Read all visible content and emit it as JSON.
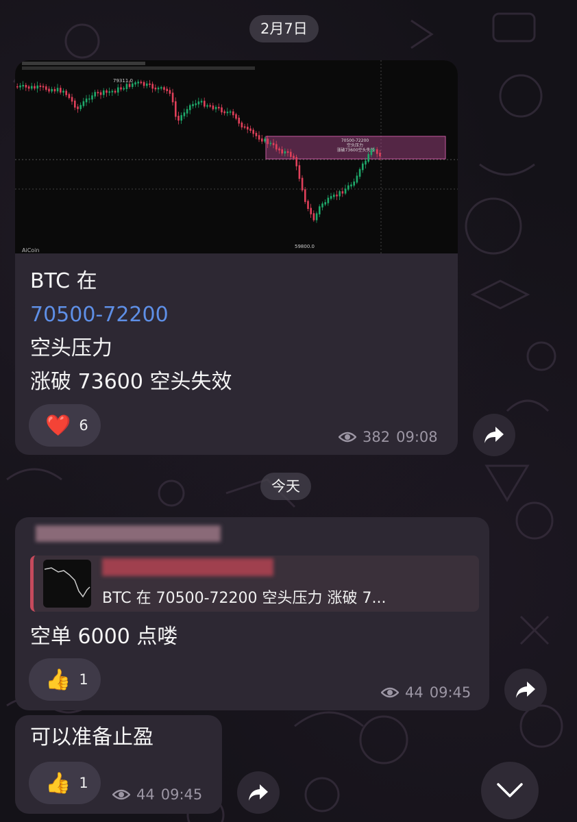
{
  "date_divider_1": "2月7日",
  "date_divider_2": "今天",
  "message1": {
    "chart_watermark": "AiCoin",
    "chart_high_label": "79311.0",
    "chart_low_label": "59800.0",
    "chart_zone_text": [
      "70500-72200",
      "空头压力",
      "涨破73600空头失效"
    ],
    "line1": "BTC 在",
    "line2": "70500-72200",
    "line3": "空头压力",
    "line4": "涨破 73600 空头失效",
    "reaction_emoji": "❤️",
    "reaction_count": "6",
    "views": "382",
    "time": "09:08"
  },
  "message2": {
    "reply_preview": "BTC 在 70500-72200 空头压力 涨破 7...",
    "text": "空单 6000 点喽",
    "reaction_emoji": "👍",
    "reaction_count": "1",
    "views": "44",
    "time": "09:45"
  },
  "message3": {
    "text": "可以准备止盈",
    "reaction_emoji": "👍",
    "reaction_count": "1",
    "views": "44",
    "time": "09:45"
  },
  "icons": {
    "views": "eye-icon",
    "share": "share-arrow-icon",
    "scroll": "chevron-down-icon"
  },
  "colors": {
    "bubble": "#2d2833",
    "accent_blue": "#5e8fe6",
    "zone_pink": "#b04a8e",
    "candle_up": "#1fa86a",
    "candle_down": "#e0405a"
  }
}
